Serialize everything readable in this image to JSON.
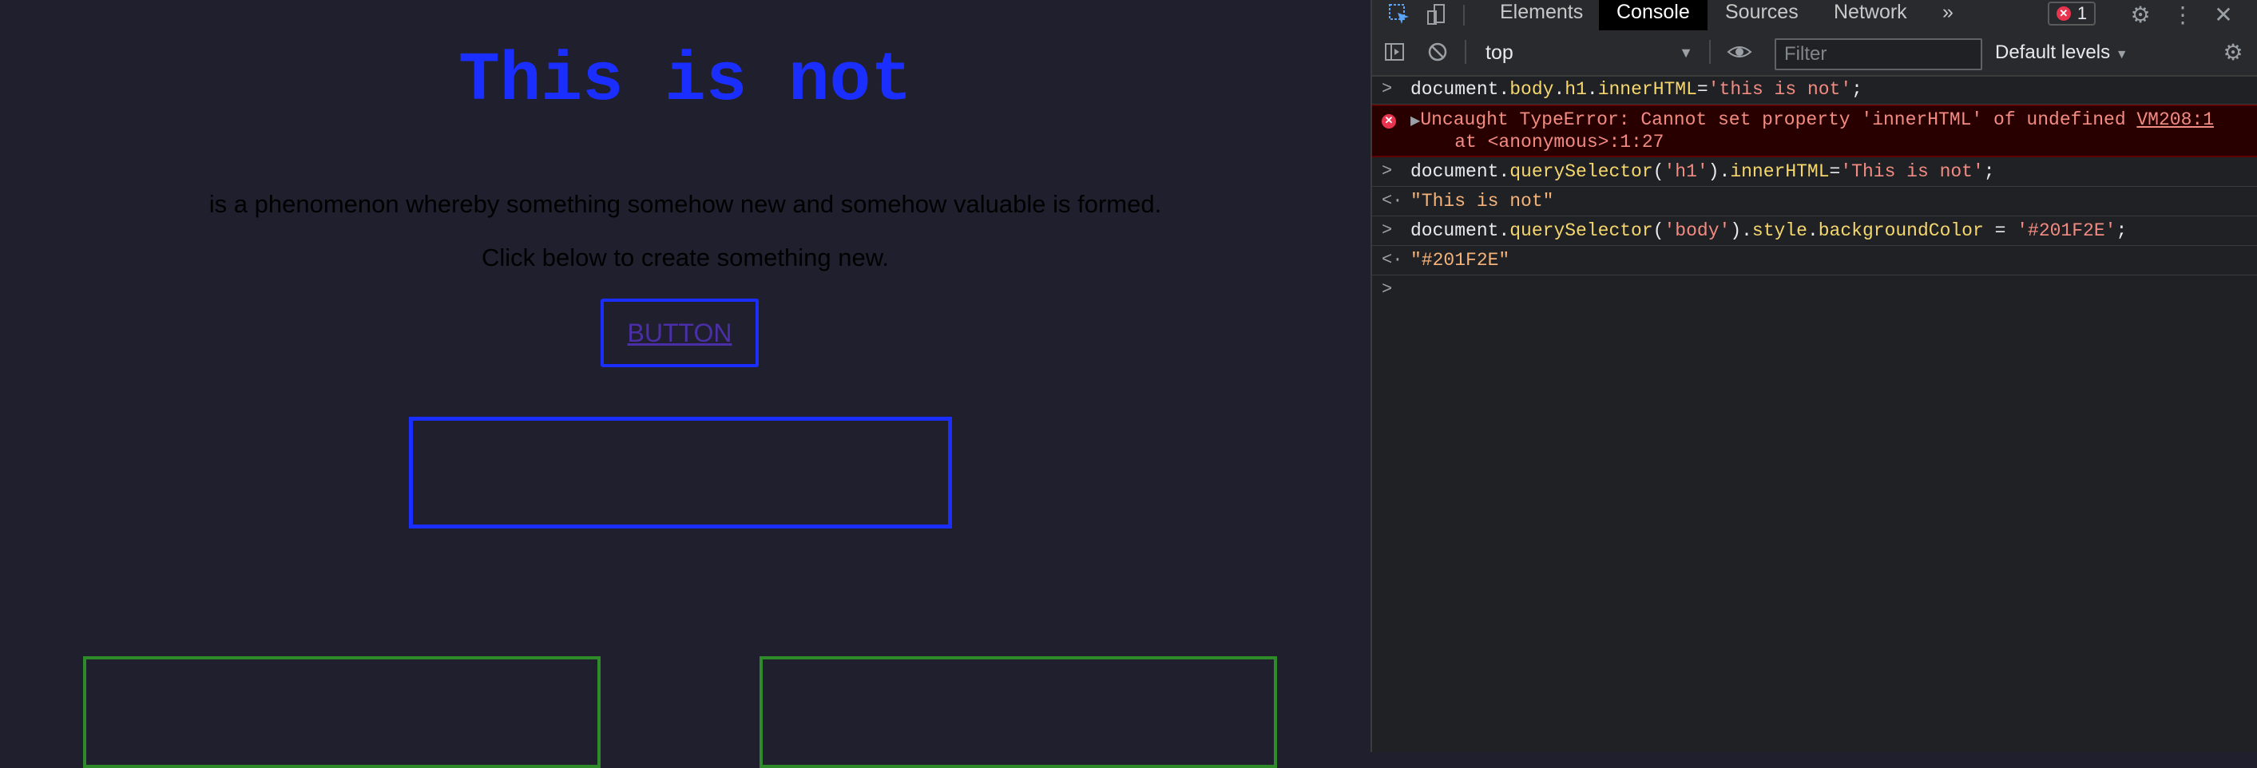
{
  "page": {
    "heading": "This is not",
    "description": "is a phenomenon whereby something somehow new and somehow valuable is formed.",
    "instruction": "Click below to create something new.",
    "button_label": "BUTTON"
  },
  "devtools": {
    "tabs": [
      "Elements",
      "Console",
      "Sources",
      "Network"
    ],
    "active_tab": "Console",
    "more_tabs": "»",
    "error_count": "1",
    "context": "top",
    "filter_placeholder": "Filter",
    "levels": "Default levels",
    "console": {
      "cmd1": {
        "a": "document.",
        "b": "body",
        "c": ".",
        "d": "h1",
        "e": ".",
        "f": "innerHTML",
        "g": "=",
        "h": "'this is not'",
        "i": ";"
      },
      "error": {
        "line1": "Uncaught TypeError: Cannot set property 'innerHTML' of undefined",
        "line2": "    at <anonymous>:1:27",
        "source": "VM208:1"
      },
      "cmd2": {
        "a": "document.",
        "b": "querySelector",
        "c": "(",
        "d": "'h1'",
        "e": ").",
        "f": "innerHTML",
        "g": "=",
        "h": "'This is not'",
        "i": ";"
      },
      "out2": "\"This is not\"",
      "cmd3": {
        "a": "document.",
        "b": "querySelector",
        "c": "(",
        "d": "'body'",
        "e": ").",
        "f": "style",
        "g": ".",
        "h": "backgroundColor",
        "i": " = ",
        "j": "'#201F2E'",
        "k": ";"
      },
      "out3": "\"#201F2E\""
    }
  },
  "colors": {
    "page_background": "#201F2E",
    "heading": "#1a2fff",
    "green_border": "#2f8a2a"
  }
}
